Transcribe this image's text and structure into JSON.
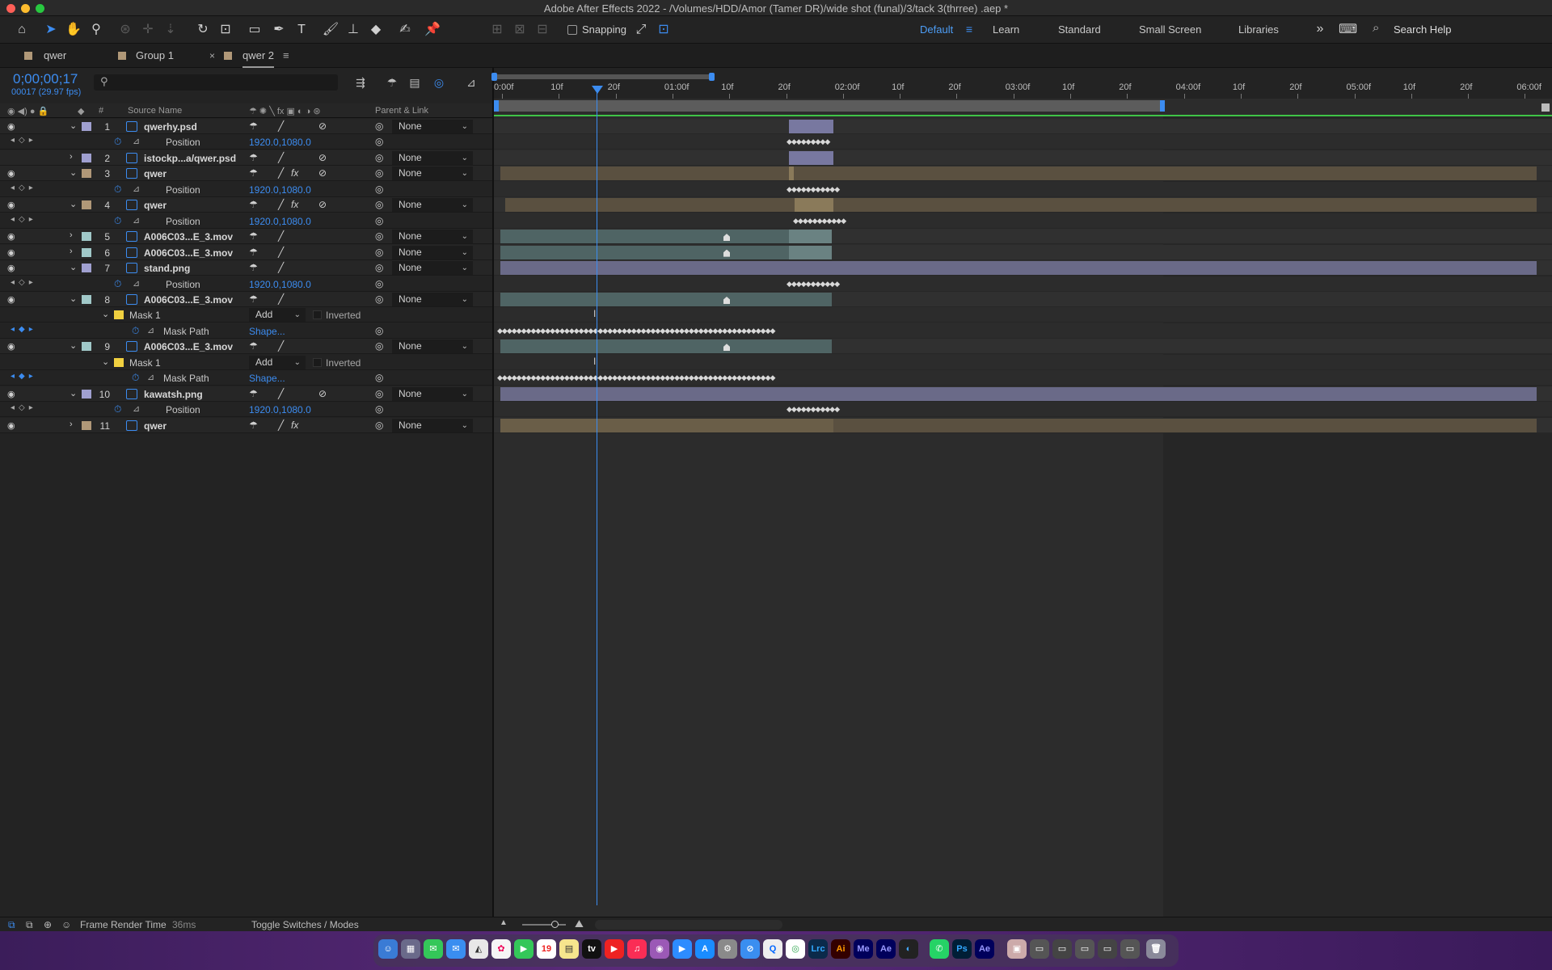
{
  "window": {
    "title": "Adobe After Effects 2022 - /Volumes/HDD/Amor (Tamer DR)/wide shot (funal)/3/tack 3(thrree) .aep *"
  },
  "toolbar": {
    "snapping_label": "Snapping",
    "workspaces": [
      "Default",
      "Learn",
      "Standard",
      "Small Screen",
      "Libraries"
    ],
    "search_help": "Search Help"
  },
  "tabs": [
    {
      "label": "qwer",
      "active": false
    },
    {
      "label": "Group 1",
      "active": false
    },
    {
      "label": "qwer 2",
      "active": true
    }
  ],
  "timeline_header": {
    "timecode": "0;00;00;17",
    "frame_info": "00017 (29.97 fps)",
    "search_placeholder": ""
  },
  "columns": {
    "num": "#",
    "source_name": "Source Name",
    "parent_link": "Parent & Link"
  },
  "ruler_ticks": [
    "0:00f",
    "10f",
    "20f",
    "01:00f",
    "10f",
    "20f",
    "02:00f",
    "10f",
    "20f",
    "03:00f",
    "10f",
    "20f",
    "04:00f",
    "10f",
    "20f",
    "05:00f",
    "10f",
    "20f",
    "06:00f"
  ],
  "rows": [
    {
      "type": "layer",
      "num": "1",
      "name": "qwerhy.psd",
      "color": "#a0a0d0",
      "parent": "None",
      "twirl": "open",
      "visible": true
    },
    {
      "type": "prop",
      "name": "Position",
      "value": "1920.0,1080.0"
    },
    {
      "type": "layer",
      "num": "2",
      "name": "istockp...a/qwer.psd",
      "color": "#a0a0d0",
      "parent": "None",
      "twirl": "closed",
      "visible": false
    },
    {
      "type": "layer",
      "num": "3",
      "name": "qwer",
      "color": "#b09878",
      "parent": "None",
      "twirl": "open",
      "visible": true,
      "fx": true
    },
    {
      "type": "prop",
      "name": "Position",
      "value": "1920.0,1080.0"
    },
    {
      "type": "layer",
      "num": "4",
      "name": "qwer",
      "color": "#b09878",
      "parent": "None",
      "twirl": "open",
      "visible": true,
      "fx": true
    },
    {
      "type": "prop",
      "name": "Position",
      "value": "1920.0,1080.0"
    },
    {
      "type": "layer",
      "num": "5",
      "name": "A006C03...E_3.mov",
      "color": "#a0c8c8",
      "parent": "None",
      "twirl": "closed",
      "visible": true
    },
    {
      "type": "layer",
      "num": "6",
      "name": "A006C03...E_3.mov",
      "color": "#a0c8c8",
      "parent": "None",
      "twirl": "closed",
      "visible": true
    },
    {
      "type": "layer",
      "num": "7",
      "name": "stand.png",
      "color": "#a0a0d0",
      "parent": "None",
      "twirl": "open",
      "visible": true
    },
    {
      "type": "prop",
      "name": "Position",
      "value": "1920.0,1080.0"
    },
    {
      "type": "layer",
      "num": "8",
      "name": "A006C03...E_3.mov",
      "color": "#a0c8c8",
      "parent": "None",
      "twirl": "open",
      "visible": true
    },
    {
      "type": "mask",
      "name": "Mask 1",
      "mode": "Add",
      "inverted": "Inverted"
    },
    {
      "type": "maskpath",
      "name": "Mask Path",
      "value": "Shape..."
    },
    {
      "type": "layer",
      "num": "9",
      "name": "A006C03...E_3.mov",
      "color": "#a0c8c8",
      "parent": "None",
      "twirl": "open",
      "visible": true
    },
    {
      "type": "mask",
      "name": "Mask 1",
      "mode": "Add",
      "inverted": "Inverted"
    },
    {
      "type": "maskpath",
      "name": "Mask Path",
      "value": "Shape..."
    },
    {
      "type": "layer",
      "num": "10",
      "name": "kawatsh.png",
      "color": "#a0a0d0",
      "parent": "None",
      "twirl": "open",
      "visible": true
    },
    {
      "type": "prop",
      "name": "Position",
      "value": "1920.0,1080.0"
    },
    {
      "type": "layer",
      "num": "11",
      "name": "qwer",
      "color": "#b09878",
      "parent": "None",
      "twirl": "closed",
      "visible": true,
      "fx": true
    }
  ],
  "status": {
    "render_label": "Frame Render Time",
    "render_value": "36ms",
    "toggle_label": "Toggle Switches / Modes"
  },
  "dock_labels": [
    "Lrc",
    "Ai",
    "Me",
    "Ae",
    "Ps",
    "Ae"
  ],
  "colors": {
    "accent": "#3c8cf0",
    "work_area_green": "#3fc447"
  }
}
